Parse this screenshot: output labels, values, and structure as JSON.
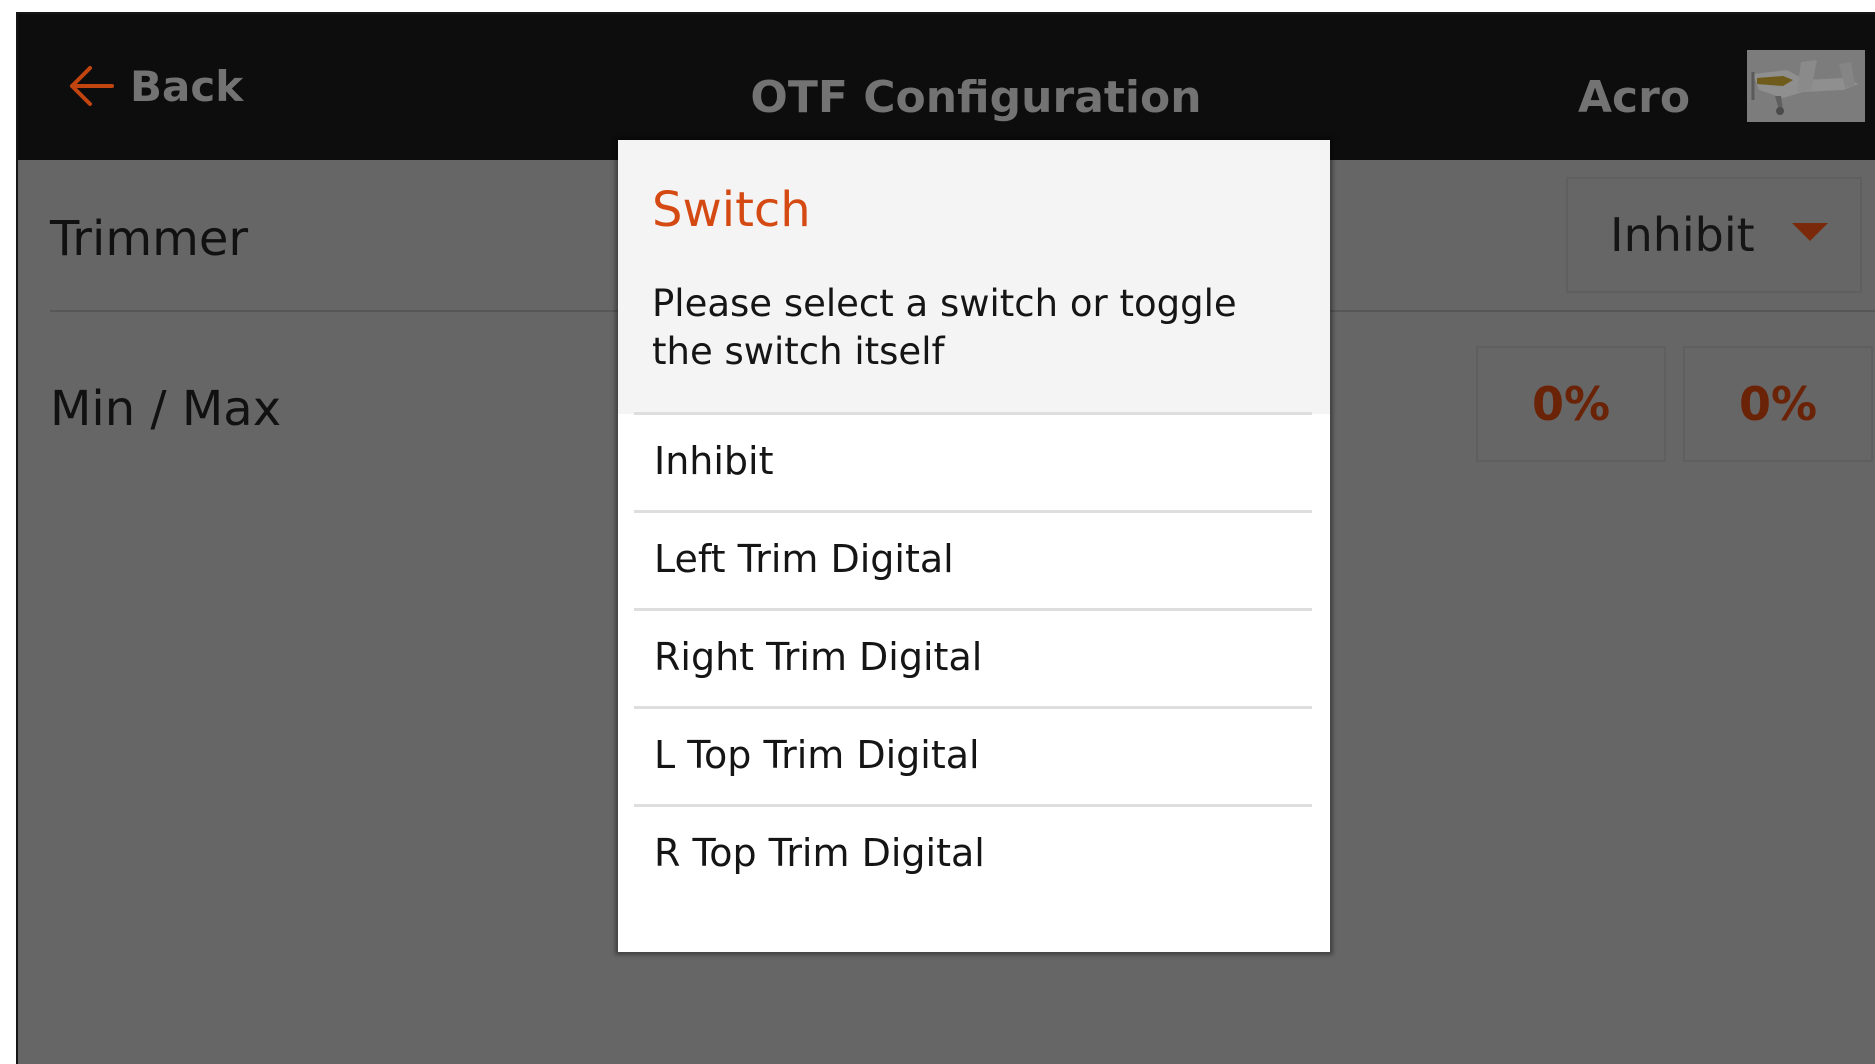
{
  "header": {
    "back_label": "Back",
    "title": "OTF Configuration",
    "model_name": "Acro",
    "accent_color": "#d44a12"
  },
  "rows": {
    "trimmer": {
      "label": "Trimmer",
      "value": "Inhibit"
    },
    "min_max": {
      "label": "Min / Max",
      "min_value": "0%",
      "max_value": "0%"
    }
  },
  "dialog": {
    "title": "Switch",
    "message": "Please select a switch or toggle the switch itself",
    "options": [
      "Inhibit",
      "Left Trim Digital",
      "Right Trim Digital",
      "L Top Trim Digital",
      "R Top Trim Digital"
    ]
  },
  "icons": {
    "back": "arrow-left-icon",
    "model": "airplane-thumbnail",
    "dropdown": "caret-down-icon"
  }
}
